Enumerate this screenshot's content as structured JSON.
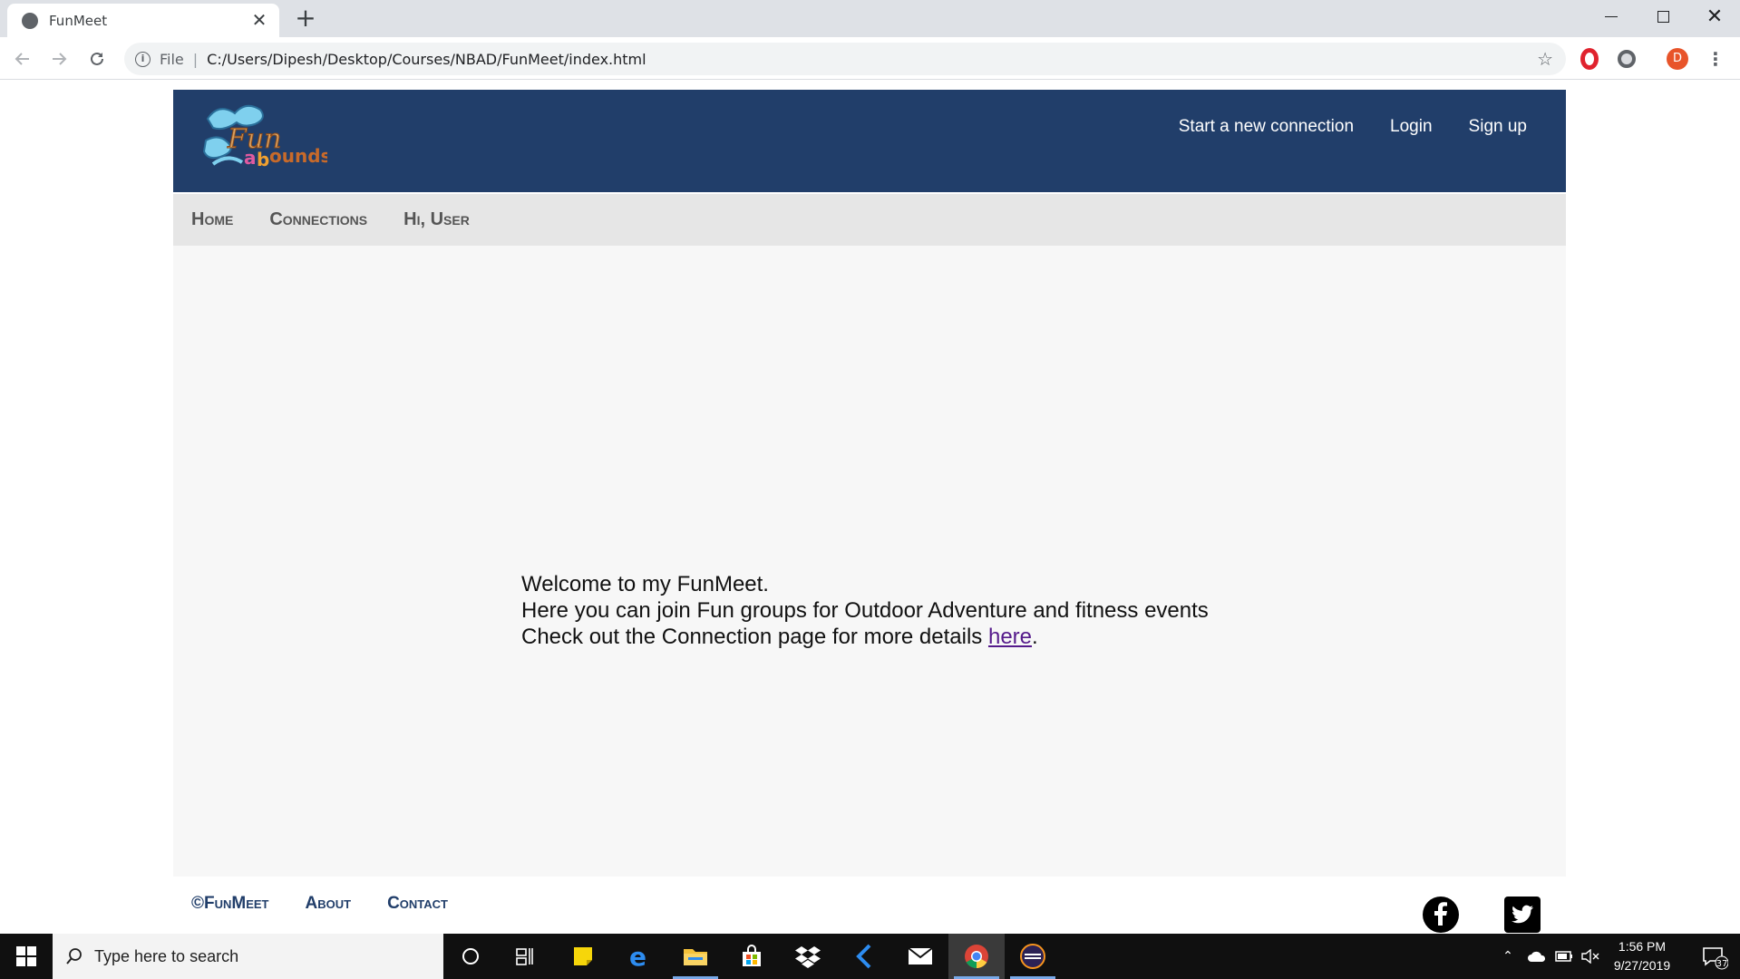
{
  "browser": {
    "tab_title": "FunMeet",
    "tab_close": "✕",
    "new_tab": "+",
    "scheme": "File",
    "url": "C:/Users/Dipesh/Desktop/Courses/NBAD/FunMeet/index.html",
    "profile_initial": "D",
    "window_close": "✕"
  },
  "site": {
    "logo_alt": "Fun abounds",
    "top_nav": [
      "Start a new connection",
      "Login",
      "Sign up"
    ],
    "sub_nav": [
      "Home",
      "Connections",
      "Hi, User"
    ],
    "welcome": {
      "line1": "Welcome to my FunMeet.",
      "line2": "Here you can join Fun groups for Outdoor Adventure and fitness events",
      "line3_prefix": "Check out the Connection page for more details ",
      "line3_link": "here",
      "line3_suffix": "."
    },
    "footer_links": [
      "©FunMeet",
      "About",
      "Contact"
    ],
    "social": [
      "facebook-icon",
      "twitter-icon"
    ]
  },
  "taskbar": {
    "search_placeholder": "Type here to search",
    "time": "1:56 PM",
    "date": "9/27/2019",
    "notifications": "37"
  },
  "colors": {
    "header_bg": "#213e6a",
    "subnav_bg": "#e6e6e6",
    "main_bg": "#f7f7f7",
    "link_visited": "#551a8b"
  }
}
